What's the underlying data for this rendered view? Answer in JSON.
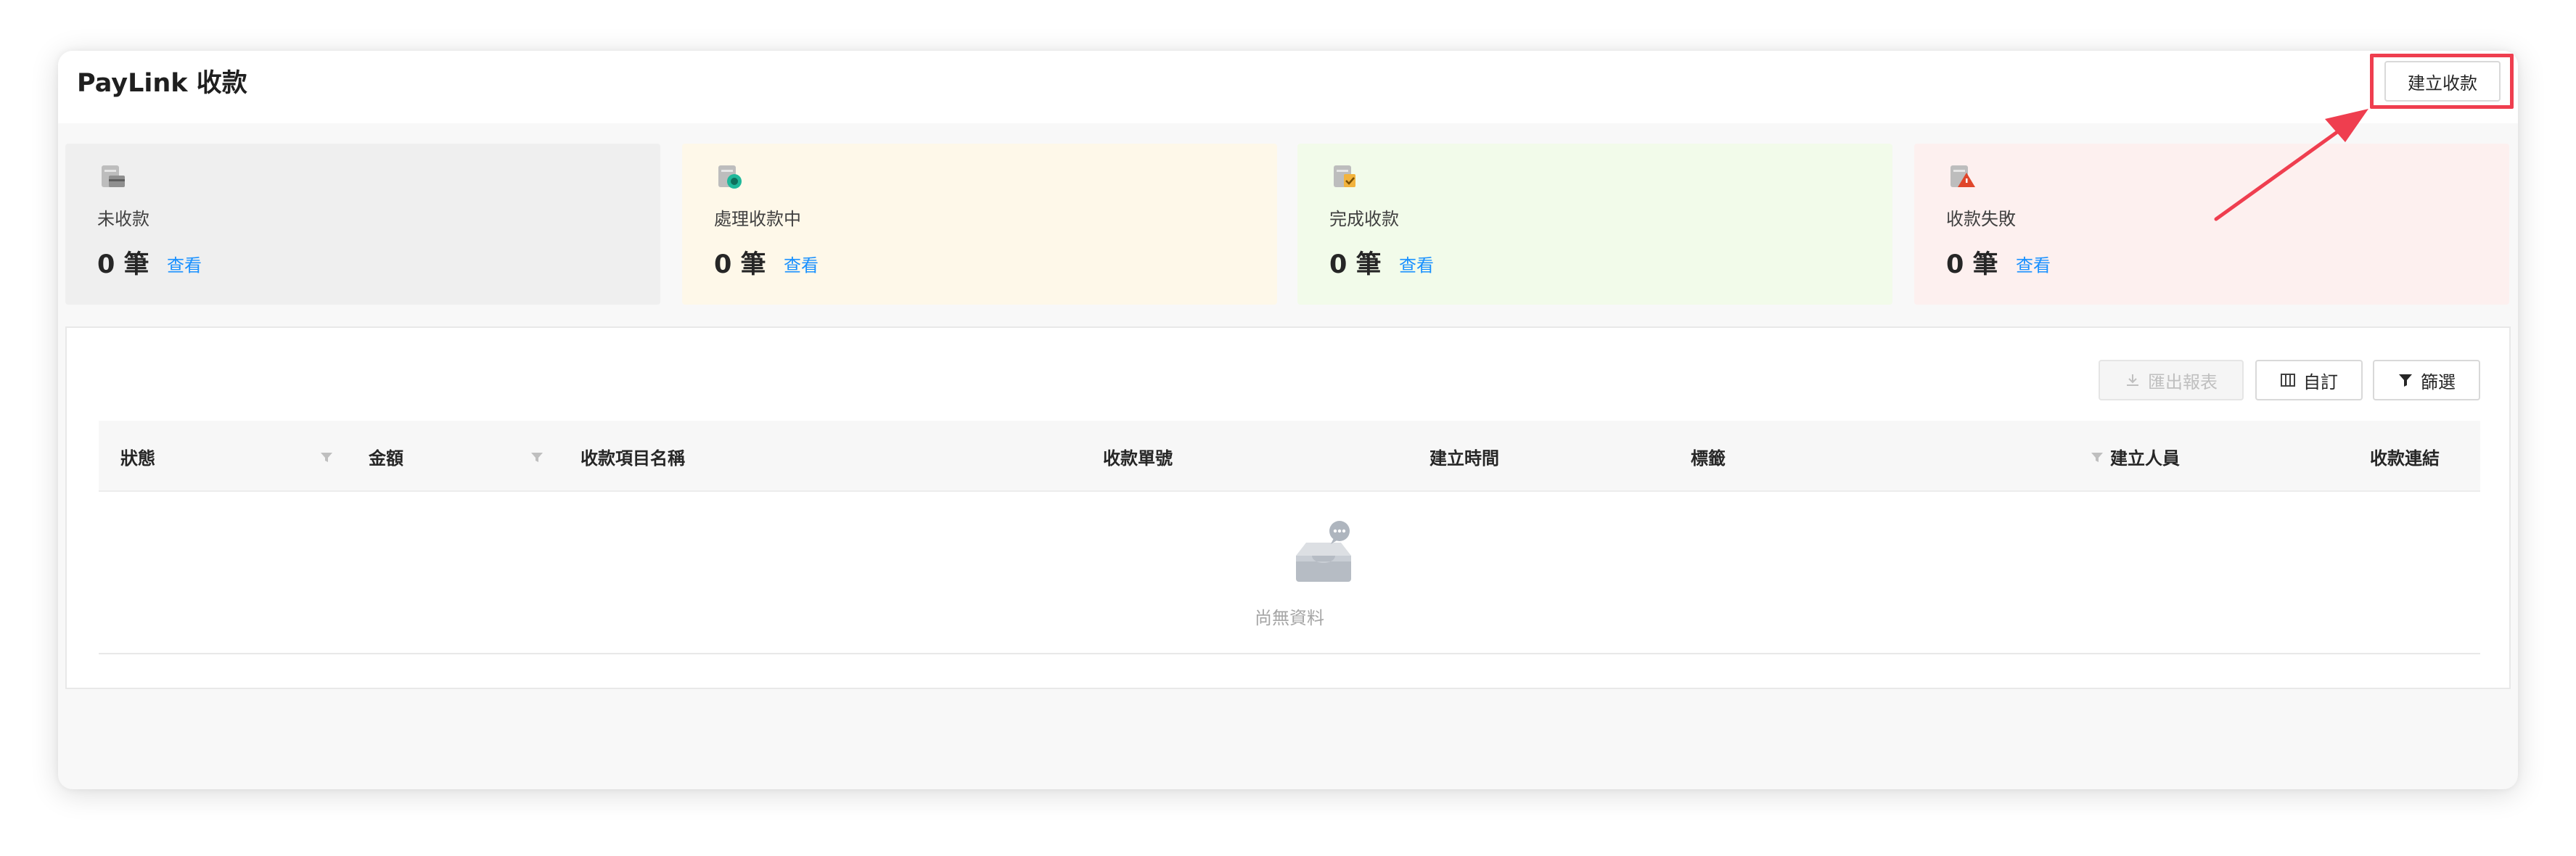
{
  "header": {
    "title": "PayLink 收款",
    "create_button": "建立收款"
  },
  "cards": [
    {
      "label": "未收款",
      "count": "0 筆",
      "view": "查看",
      "icon": "unpaid-icon"
    },
    {
      "label": "處理收款中",
      "count": "0 筆",
      "view": "查看",
      "icon": "processing-icon"
    },
    {
      "label": "完成收款",
      "count": "0 筆",
      "view": "查看",
      "icon": "completed-icon"
    },
    {
      "label": "收款失敗",
      "count": "0 筆",
      "view": "查看",
      "icon": "failed-icon"
    }
  ],
  "toolbar": {
    "export": "匯出報表",
    "custom": "自訂",
    "filter": "篩選"
  },
  "table": {
    "columns": [
      "狀態",
      "金額",
      "收款項目名稱",
      "收款單號",
      "建立時間",
      "標籤",
      "建立人員",
      "收款連結"
    ],
    "empty_text": "尚無資料"
  },
  "colors": {
    "link": "#1890ff",
    "highlight": "#ef3e4f",
    "card_unpaid": "#efefef",
    "card_processing": "#fef8e9",
    "card_completed": "#f2fbea",
    "card_failed": "#fdf0ef"
  }
}
